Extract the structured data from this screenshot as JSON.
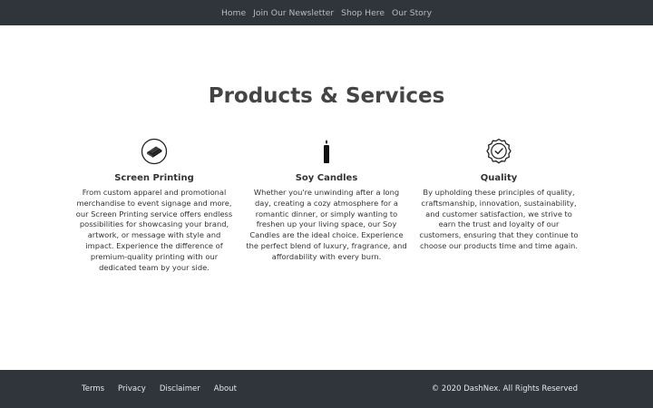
{
  "nav": {
    "items": [
      "Home",
      "Join Our Newsletter",
      "Shop Here",
      "Our Story"
    ]
  },
  "main": {
    "title": "Products & Services",
    "features": [
      {
        "icon": "printer-icon",
        "title": "Screen Printing",
        "description": "From custom apparel and promotional merchandise to event signage and more, our Screen Printing service offers endless possibilities for showcasing your brand, artwork, or message with style and impact. Experience the difference of premium-quality printing with our dedicated team by your side."
      },
      {
        "icon": "candle-icon",
        "title": "Soy Candles",
        "description": "Whether you're unwinding after a long day, creating a cozy atmosphere for a romantic dinner, or simply wanting to freshen up your living space, our Soy Candles are the ideal choice. Experience the perfect blend of luxury, fragrance, and affordability with every burn."
      },
      {
        "icon": "quality-badge-icon",
        "title": "Quality",
        "description": "By upholding these principles of quality, craftsmanship, innovation, sustainability, and customer satisfaction, we strive to earn the trust and loyalty of our customers, ensuring that they continue to choose our products time and time again."
      }
    ]
  },
  "footer": {
    "links": [
      "Terms",
      "Privacy",
      "Disclaimer",
      "About"
    ],
    "copyright": "© 2020 DashNex. All Rights Reserved"
  },
  "colors": {
    "nav_bg": "#30353b",
    "nav_text": "#b8bcc2",
    "footer_bg": "#30353b",
    "title": "#444444",
    "badge": "#2a79c7"
  }
}
